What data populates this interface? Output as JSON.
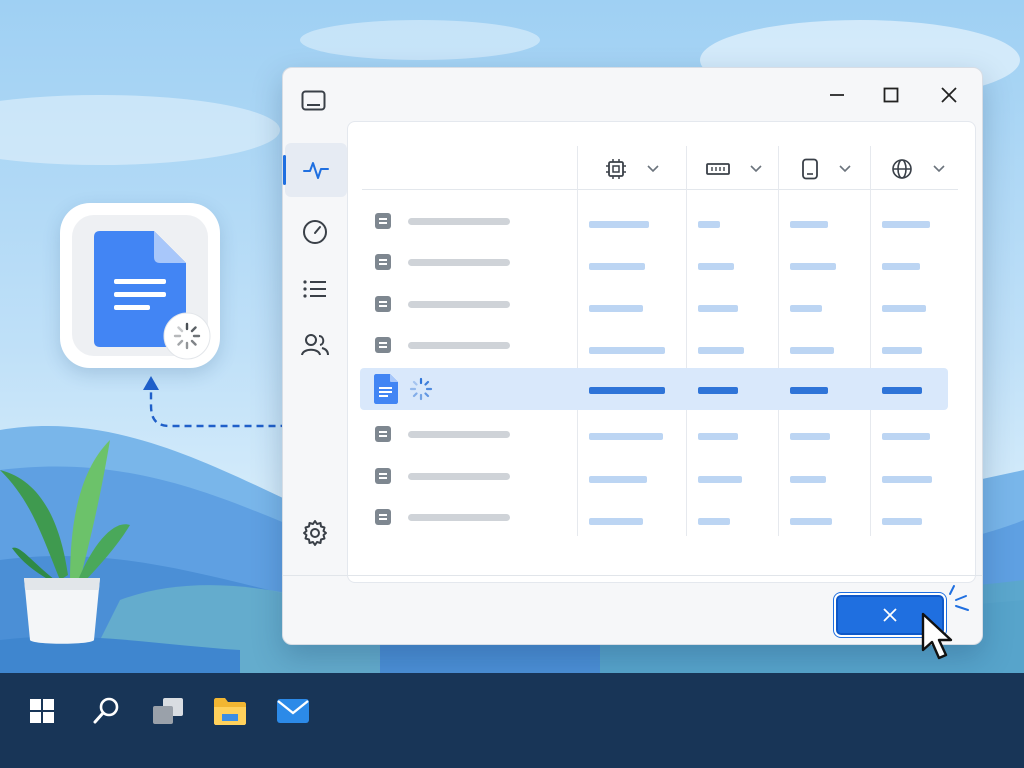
{
  "desktop": {
    "app_icon": "google-docs-icon",
    "loading_badge": "spinner-icon"
  },
  "window": {
    "title_icon": "task-manager-icon",
    "controls": [
      {
        "name": "minimize-icon"
      },
      {
        "name": "maximize-icon"
      },
      {
        "name": "close-icon"
      }
    ],
    "sidebar": {
      "items": [
        {
          "name": "performance-icon",
          "active": true
        },
        {
          "name": "speedometer-icon",
          "active": false
        },
        {
          "name": "list-icon",
          "active": false
        },
        {
          "name": "users-icon",
          "active": false
        }
      ],
      "settings_icon": "gear-icon"
    },
    "columns": [
      {
        "icon": "cpu-icon"
      },
      {
        "icon": "memory-icon"
      },
      {
        "icon": "disk-icon"
      },
      {
        "icon": "network-icon"
      }
    ],
    "rows": [
      {
        "icon": "process-icon",
        "selected": false
      },
      {
        "icon": "process-icon",
        "selected": false
      },
      {
        "icon": "process-icon",
        "selected": false
      },
      {
        "icon": "process-icon",
        "selected": false
      },
      {
        "icon": "google-docs-icon",
        "selected": true,
        "status_icon": "spinner-icon"
      },
      {
        "icon": "process-icon",
        "selected": false
      },
      {
        "icon": "process-icon",
        "selected": false
      },
      {
        "icon": "process-icon",
        "selected": false
      }
    ],
    "end_task_button_icon": "close-icon"
  },
  "taskbar": {
    "items": [
      {
        "name": "windows-start-icon"
      },
      {
        "name": "search-icon"
      },
      {
        "name": "task-view-icon"
      },
      {
        "name": "file-explorer-icon"
      },
      {
        "name": "mail-icon"
      }
    ]
  },
  "colors": {
    "accent": "#1f6fe0",
    "selected_row": "#d9e8fb",
    "taskbar": "#183557",
    "docs_blue": "#4285f4"
  }
}
